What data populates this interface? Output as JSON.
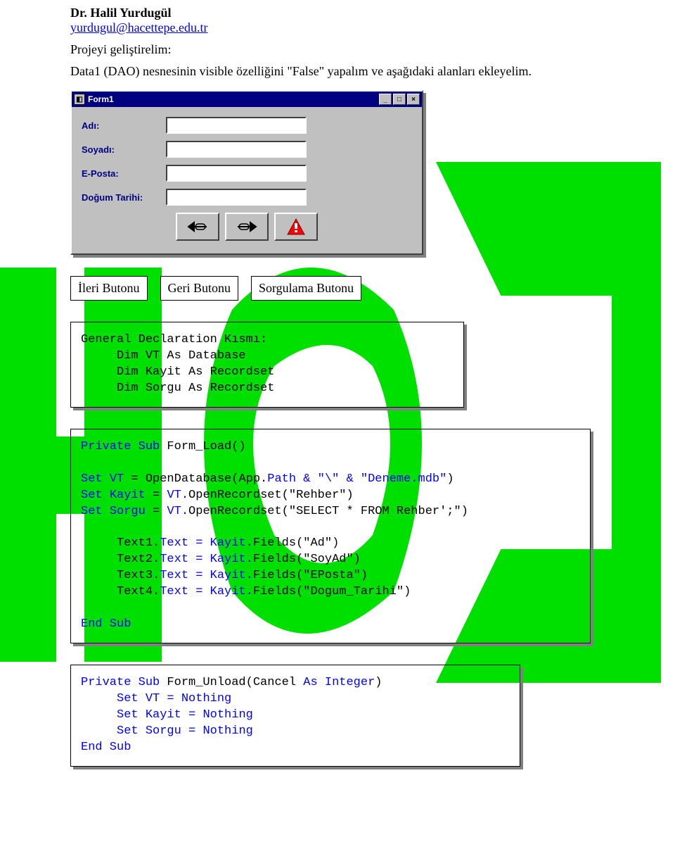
{
  "header": {
    "name": "Dr. Halil Yurdugül",
    "email": "yurdugul@hacettepe.edu.tr"
  },
  "intro": {
    "line1": "Projeyi geliştirelim:",
    "line2": "Data1 (DAO) nesnesinin visible özelliğini \"False\" yapalım ve aşağıdaki alanları ekleyelim."
  },
  "vbform": {
    "title": "Form1",
    "labels": {
      "adi": "Adı:",
      "soyadi": "Soyadı:",
      "eposta": "E-Posta:",
      "dogum": "Doğum Tarihi:"
    }
  },
  "callouts": {
    "ileri": "İleri Butonu",
    "geri": "Geri Butonu",
    "sorgu": "Sorgulama Butonu"
  },
  "code1": {
    "l1": "General Declaration Kısmı:",
    "l2": "     Dim VT As Database",
    "l3": "     Dim Kayit As Recordset",
    "l4": "     Dim Sorgu As Recordset"
  },
  "code2": {
    "l1a": "Private Sub",
    "l1b": " Form_Load()",
    "l3a": "Set ",
    "l3b": "VT",
    "l3c": " = OpenDatabase(App.",
    "l3d": "Path & \"\\\" & \"Deneme.mdb\"",
    "l3e": ")",
    "l4a": "Set ",
    "l4b": "Kayit",
    "l4c": " = ",
    "l4d": "VT.",
    "l4e": "OpenRecordset(\"Rehber\")",
    "l5a": "Set ",
    "l5b": "Sorgu",
    "l5c": " = ",
    "l5d": "VT.",
    "l5e": "OpenRecordset(\"SELECT * FROM Rehber';\")",
    "l7a": "     Text1.",
    "l7b": "Text = ",
    "l7c": "Kayit.",
    "l7d": "Fields(\"Ad\")",
    "l8a": "     Text2.",
    "l8b": "Text = ",
    "l8c": "Kayit.",
    "l8d": "Fields(\"SoyAd\")",
    "l9a": "     Text3.",
    "l9b": "Text = ",
    "l9c": "Kayit.",
    "l9d": "Fields(\"EPosta\")",
    "l10a": "     Text4.",
    "l10b": "Text = ",
    "l10c": "Kayit.",
    "l10d": "Fields(\"Dogum_Tarihi\")",
    "l12": "End Sub"
  },
  "code3": {
    "l1a": "Private Sub",
    "l1b": " Form_Unload(Cancel ",
    "l1c": "As Integer",
    "l1d": ")",
    "l2a": "     Set ",
    "l2b": "VT",
    "l2c": " = Nothing",
    "l3a": "     Set ",
    "l3b": "Kayit",
    "l3c": " = Nothing",
    "l4a": "     Set ",
    "l4b": "Sorgu",
    "l4c": " = Nothing",
    "l5": "End Sub"
  }
}
